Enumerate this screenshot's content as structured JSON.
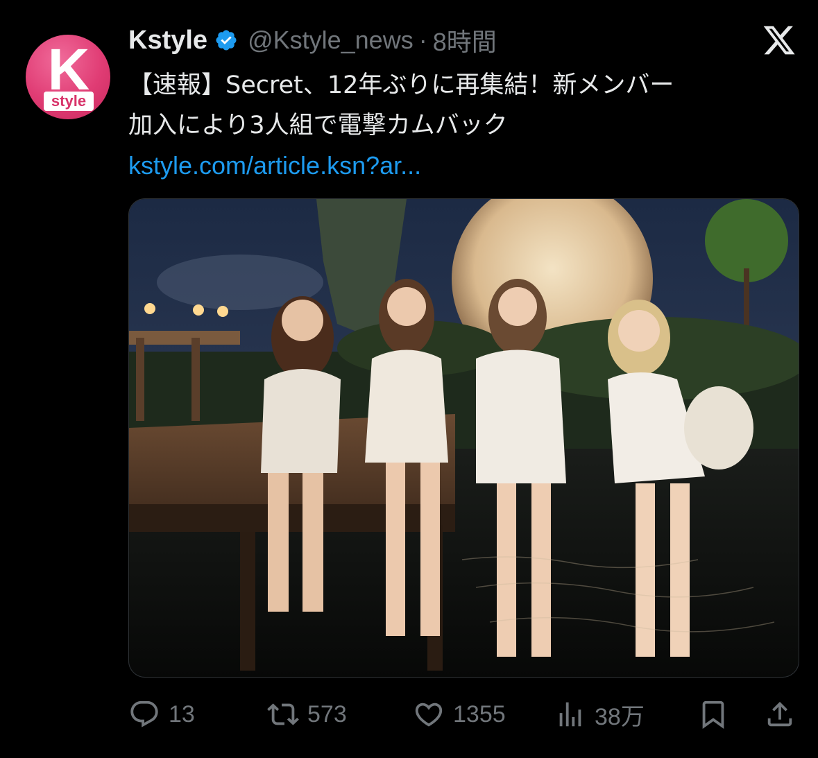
{
  "account": {
    "avatar_letter": "K",
    "avatar_badge": "style",
    "display_name": "Kstyle",
    "handle": "@Kstyle_news",
    "separator": "·",
    "time": "8時間"
  },
  "tweet": {
    "text_line1": "【速報】Secret、12年ぶりに再集結！新メンバー",
    "text_line2": "加入により3人組で電撃カムバック",
    "link": "kstyle.com/article.ksn?ar..."
  },
  "actions": {
    "replies": "13",
    "retweets": "573",
    "likes": "1355",
    "views": "38万"
  },
  "icons": {
    "verified": "verified-badge-icon",
    "x": "x-logo-icon",
    "reply": "reply-icon",
    "retweet": "retweet-icon",
    "like": "heart-icon",
    "views": "views-icon",
    "bookmark": "bookmark-icon",
    "share": "share-icon"
  },
  "colors": {
    "background": "#000000",
    "text": "#e7e9ea",
    "muted": "#71767b",
    "link": "#1d9bf0",
    "avatar": "#e03c74"
  }
}
